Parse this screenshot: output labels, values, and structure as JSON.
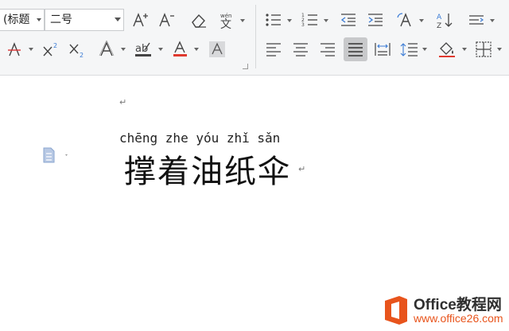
{
  "ribbon": {
    "style_combo": {
      "value": "(标题"
    },
    "size_combo": {
      "value": "二号"
    },
    "buttons_row1": [
      {
        "name": "grow-font-button",
        "glyph": "A⁺"
      },
      {
        "name": "shrink-font-button",
        "glyph": "A⁻"
      },
      {
        "name": "clear-format-button",
        "glyph": "◇"
      },
      {
        "name": "phonetic-guide-button",
        "glyph": "变"
      },
      {
        "name": "bullets-button",
        "glyph": "☰"
      },
      {
        "name": "numbering-button",
        "glyph": "☰"
      },
      {
        "name": "decrease-indent-button",
        "glyph": "⇤"
      },
      {
        "name": "increase-indent-button",
        "glyph": "⇥"
      },
      {
        "name": "change-case-button",
        "glyph": "A"
      },
      {
        "name": "sort-button",
        "glyph": "A↓"
      },
      {
        "name": "text-direction-button",
        "glyph": "⇆"
      }
    ],
    "buttons_row2": [
      {
        "name": "strikethrough-button",
        "glyph": "A"
      },
      {
        "name": "superscript-button",
        "glyph": "X²"
      },
      {
        "name": "subscript-button",
        "glyph": "X₂"
      },
      {
        "name": "text-effect-button",
        "glyph": "A"
      },
      {
        "name": "highlight-button",
        "glyph": "ab"
      },
      {
        "name": "font-color-button",
        "glyph": "A"
      },
      {
        "name": "char-shading-button",
        "glyph": "A"
      },
      {
        "name": "align-left-button",
        "glyph": "≡"
      },
      {
        "name": "align-center-button",
        "glyph": "≡"
      },
      {
        "name": "align-right-button",
        "glyph": "≡"
      },
      {
        "name": "justify-button",
        "glyph": "≡"
      },
      {
        "name": "distributed-button",
        "glyph": "⇔"
      },
      {
        "name": "line-spacing-button",
        "glyph": "↕"
      },
      {
        "name": "shading-button",
        "glyph": "◇"
      },
      {
        "name": "borders-button",
        "glyph": "⊞"
      }
    ],
    "colors": {
      "font_color_bar": "#e03a2f",
      "strikethrough_color": "#d33"
    }
  },
  "document": {
    "pinyin": "chēng zhe yóu zhǐ sǎn",
    "text": "撑着油纸伞",
    "paragraph_mark": "↵"
  },
  "watermark": {
    "title": "Office教程网",
    "url": "www.office26.com",
    "brand_color": "#e8541c"
  }
}
